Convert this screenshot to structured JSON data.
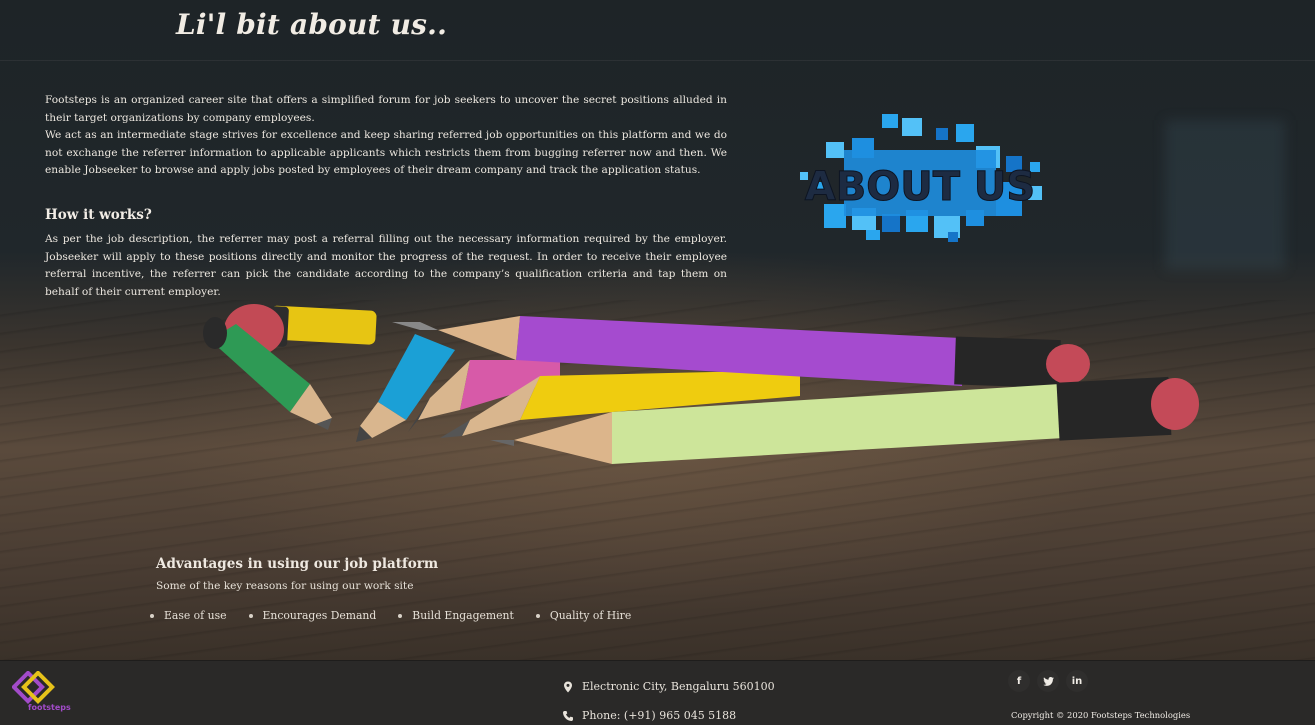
{
  "header": {
    "title": "Li'l bit about us.."
  },
  "intro": {
    "paragraph1": "Footsteps is an organized career site that offers a simplified forum for job seekers to uncover the secret positions alluded in their target organizations by company employees.",
    "paragraph2": "We act as an intermediate stage strives for excellence and keep sharing referred job opportunities on this platform and we do not exchange the referrer information to applicable applicants which restricts them from bugging referrer now and then. We enable Jobseeker to browse and apply jobs posted by employees of their dream company and track the application status."
  },
  "how_it_works": {
    "title": "How it works?",
    "text": "As per the job description, the referrer may post a referral filling out the necessary information required by the employer. Jobseeker will apply to these positions directly and monitor the progress of the request. In order to receive their employee referral incentive, the referrer can pick the candidate according to the company’s qualification criteria and tap them on behalf of their current employer."
  },
  "about_logo": {
    "text": "ABOUT US",
    "icon": "about-us-graphic"
  },
  "advantages": {
    "title": "Advantages in using our job platform",
    "subtitle": "Some of the key reasons for using our work site",
    "items": [
      "Ease of use",
      "Encourages Demand",
      "Build Engagement",
      "Quality of Hire"
    ]
  },
  "footer": {
    "brand_name": "footsteps",
    "address": "Electronic City, Bengaluru 560100",
    "phone": "Phone: (+91) 965 045 5188",
    "social": [
      {
        "icon": "facebook-icon",
        "glyph": "f"
      },
      {
        "icon": "twitter-icon",
        "glyph": "t"
      },
      {
        "icon": "linkedin-icon",
        "glyph": "in"
      }
    ],
    "copyright": "Copyright © 2020 Footsteps Technologies"
  },
  "colors": {
    "brand_purple": "#a24bc9",
    "brand_yellow": "#e6c21a",
    "about_blue": "#1e8fe0",
    "footer_bg": "#2a2928"
  }
}
